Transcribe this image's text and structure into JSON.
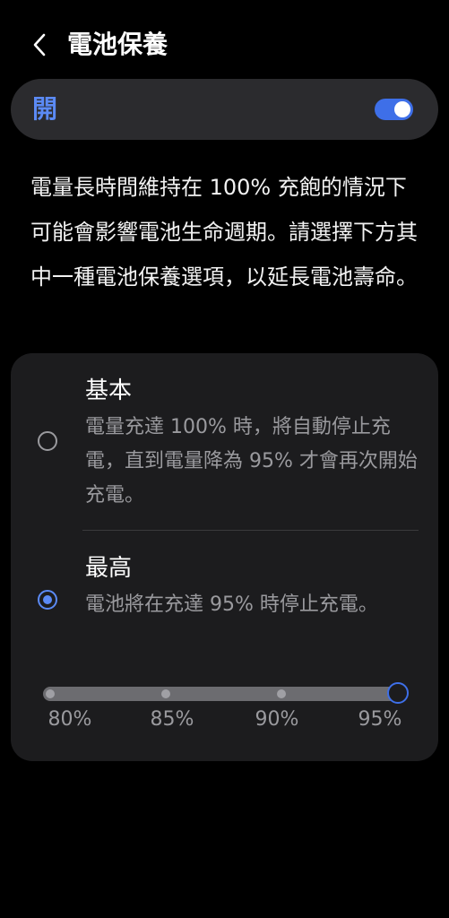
{
  "header": {
    "back_icon": "chevron-left-icon",
    "title": "電池保養"
  },
  "master": {
    "label": "開",
    "enabled": true,
    "accent_color": "#5b8af5"
  },
  "description": "電量長時間維持在 100% 充飽的情況下可能會影響電池生命週期。請選擇下方其中一種電池保養選項，以延長電池壽命。",
  "options": [
    {
      "title": "基本",
      "description": "電量充達 100% 時，將自動停止充電，直到電量降為 95% 才會再次開始充電。",
      "selected": false
    },
    {
      "title": "最高",
      "description": "電池將在充達 95% 時停止充電。",
      "selected": true
    }
  ],
  "slider": {
    "labels": [
      "80%",
      "85%",
      "90%",
      "95%"
    ],
    "value": "95%"
  }
}
